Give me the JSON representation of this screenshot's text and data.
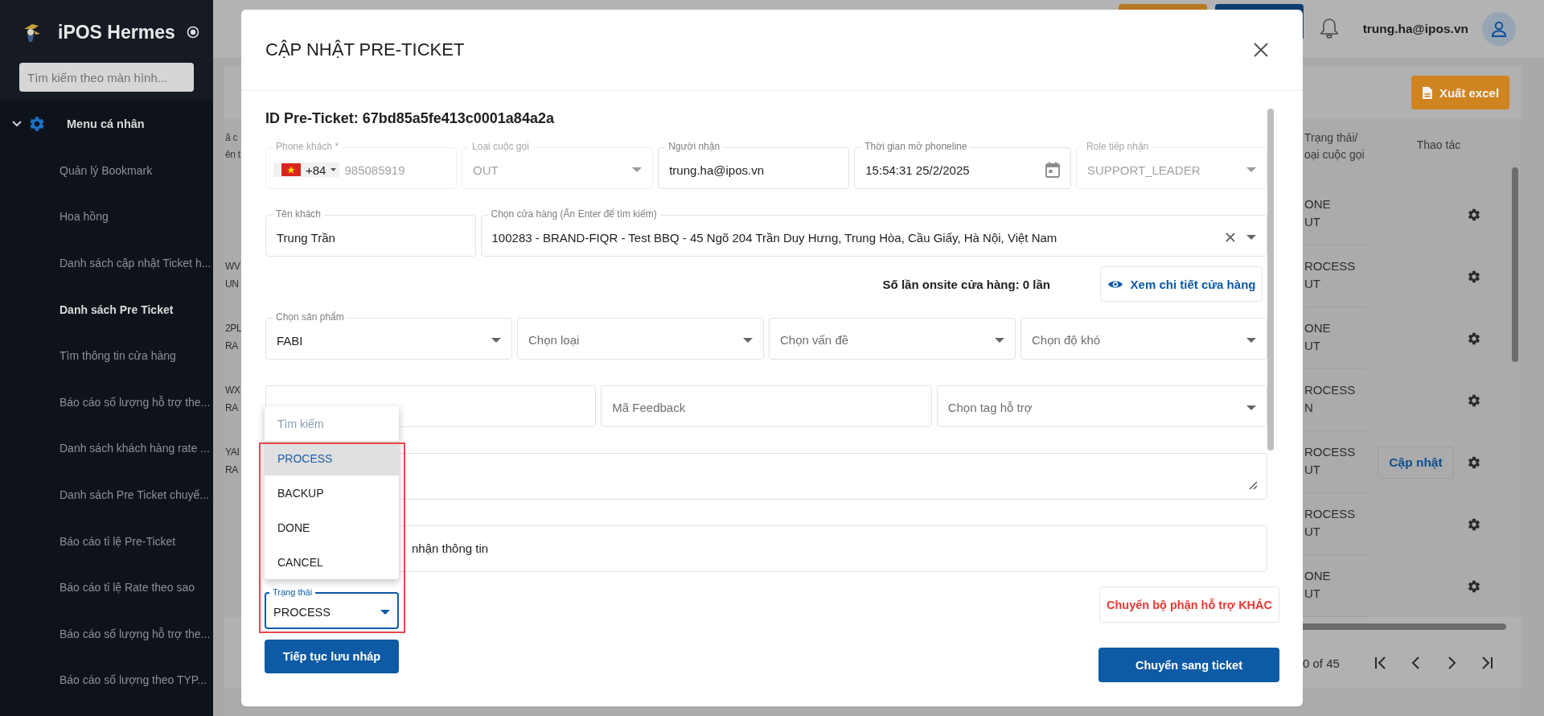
{
  "sidebar": {
    "brand": "iPOS Hermes",
    "search": {
      "placeholder": "Tìm kiếm theo màn hình..."
    },
    "menu": [
      {
        "label": "Menu cá nhân",
        "expanded": true,
        "children": [
          {
            "label": "Quản lý Bookmark",
            "selected": false
          },
          {
            "label": "Hoa hồng",
            "selected": false
          },
          {
            "label": "Danh sách cập nhật Ticket h...",
            "selected": false
          },
          {
            "label": "Danh sách Pre Ticket",
            "selected": true
          },
          {
            "label": "Tìm thông tin cửa hàng",
            "selected": false
          },
          {
            "label": "Báo cáo số lượng hỗ trợ the...",
            "selected": false
          },
          {
            "label": "Danh sách khách hàng rate ...",
            "selected": false
          },
          {
            "label": "Danh sách Pre Ticket chuyể...",
            "selected": false
          },
          {
            "label": "Báo cáo tỉ lệ Pre-Ticket",
            "selected": false
          },
          {
            "label": "Báo cáo tỉ lệ Rate theo sao",
            "selected": false
          },
          {
            "label": "Báo cáo số lượng hỗ trợ the...",
            "selected": false
          },
          {
            "label": "Báo cáo số lượng theo TYP...",
            "selected": false
          }
        ]
      }
    ]
  },
  "topbar": {
    "user_email": "trung.ha@ipos.vn"
  },
  "page": {
    "export_button": "Xuất excel",
    "table": {
      "left_header": [
        "ã c",
        "ên t"
      ],
      "status_header": [
        "Trạng thái/",
        "oại cuộc gọi"
      ],
      "actions_header": "Thao tác",
      "rows": [
        {
          "status": "ONE",
          "call_type": "UT"
        },
        {
          "left": [
            "WV",
            "UN"
          ],
          "status": "ROCESS",
          "call_type": "UT"
        },
        {
          "left": [
            "2PL",
            "RA"
          ],
          "status": "ONE",
          "call_type": "UT"
        },
        {
          "left": [
            "WX",
            "RA"
          ],
          "status": "ROCESS",
          "call_type": "N"
        },
        {
          "left": [
            "YAI",
            "RA"
          ],
          "status": "ROCESS",
          "call_type": "UT",
          "update_button": "Cập nhật"
        },
        {
          "status": "ROCESS",
          "call_type": "UT"
        },
        {
          "status": "ONE",
          "call_type": "UT"
        }
      ]
    },
    "pagination": {
      "range_text": "0 of 45"
    }
  },
  "modal": {
    "title": "CẬP NHẬT PRE-TICKET",
    "id_text": "ID Pre-Ticket: 67bd85a5fe413c0001a84a2a",
    "form": [
      {
        "kind": "fields",
        "fields": [
          {
            "kind": "phone",
            "label": "Phone khách *",
            "country_code": "+84",
            "value": "985085919",
            "disabled": true
          },
          {
            "kind": "select",
            "label": "Loại cuộc gọi",
            "value": "OUT",
            "disabled": true
          },
          {
            "kind": "text",
            "label": "Người nhận",
            "value": "trung.ha@ipos.vn",
            "disabled": false
          },
          {
            "kind": "date",
            "label": "Thời gian mở phoneline",
            "value": "15:54:31 25/2/2025",
            "disabled": false
          },
          {
            "kind": "select",
            "label": "Role tiếp nhận",
            "value": "SUPPORT_LEADER",
            "disabled": true
          }
        ]
      },
      {
        "kind": "fields",
        "fields": [
          {
            "kind": "text",
            "label": "Tên khách",
            "value": "Trung Trần",
            "disabled": false
          },
          {
            "kind": "autocomplete",
            "label": "Chọn cửa hàng (Ấn Enter để tìm kiếm)",
            "value": "100283 - BRAND-FIQR - Test BBQ - 45 Ngõ 204 Trần Duy Hưng, Trung Hòa, Cầu Giấy, Hà Nội, Việt Nam",
            "disabled": false
          }
        ]
      },
      {
        "kind": "onsite",
        "text": "Số lần onsite cửa hàng: 0 lần",
        "button": "Xem chi tiết cửa hàng"
      },
      {
        "kind": "fields",
        "fields": [
          {
            "kind": "select",
            "label": "Chọn sản phẩm",
            "value": "FABI",
            "disabled": false
          },
          {
            "kind": "select",
            "placeholder": "Chọn loại",
            "disabled": false
          },
          {
            "kind": "select",
            "placeholder": "Chọn vấn đề",
            "disabled": false
          },
          {
            "kind": "select",
            "placeholder": "Chọn độ khó",
            "disabled": false
          }
        ]
      },
      {
        "kind": "fields",
        "fields": [
          {
            "kind": "text",
            "disabled": false
          },
          {
            "kind": "text",
            "placeholder": "Mã Feedback",
            "disabled": false
          },
          {
            "kind": "select",
            "placeholder": "Chọn tag hỗ trợ",
            "disabled": false
          }
        ]
      },
      {
        "kind": "fields",
        "fields": [
          {
            "kind": "textarea",
            "disabled": false
          }
        ]
      },
      {
        "kind": "fields",
        "fields": [
          {
            "kind": "textarea",
            "value": "nhận thông tin",
            "disabled": false
          }
        ]
      }
    ],
    "status_select": {
      "label": "Trạng thái",
      "value": "PROCESS",
      "focused": true,
      "open": true,
      "highlighted": true,
      "search_placeholder": "Tìm kiếm",
      "options": [
        {
          "label": "PROCESS",
          "selected": true
        },
        {
          "label": "BACKUP",
          "selected": false
        },
        {
          "label": "DONE",
          "selected": false
        },
        {
          "label": "CANCEL",
          "selected": false
        }
      ]
    },
    "transfer_button": "Chuyển bộ phận hỗ trợ KHÁC",
    "draft_button": "Tiếp tục lưu nháp",
    "convert_button": "Chuyển sang ticket"
  }
}
